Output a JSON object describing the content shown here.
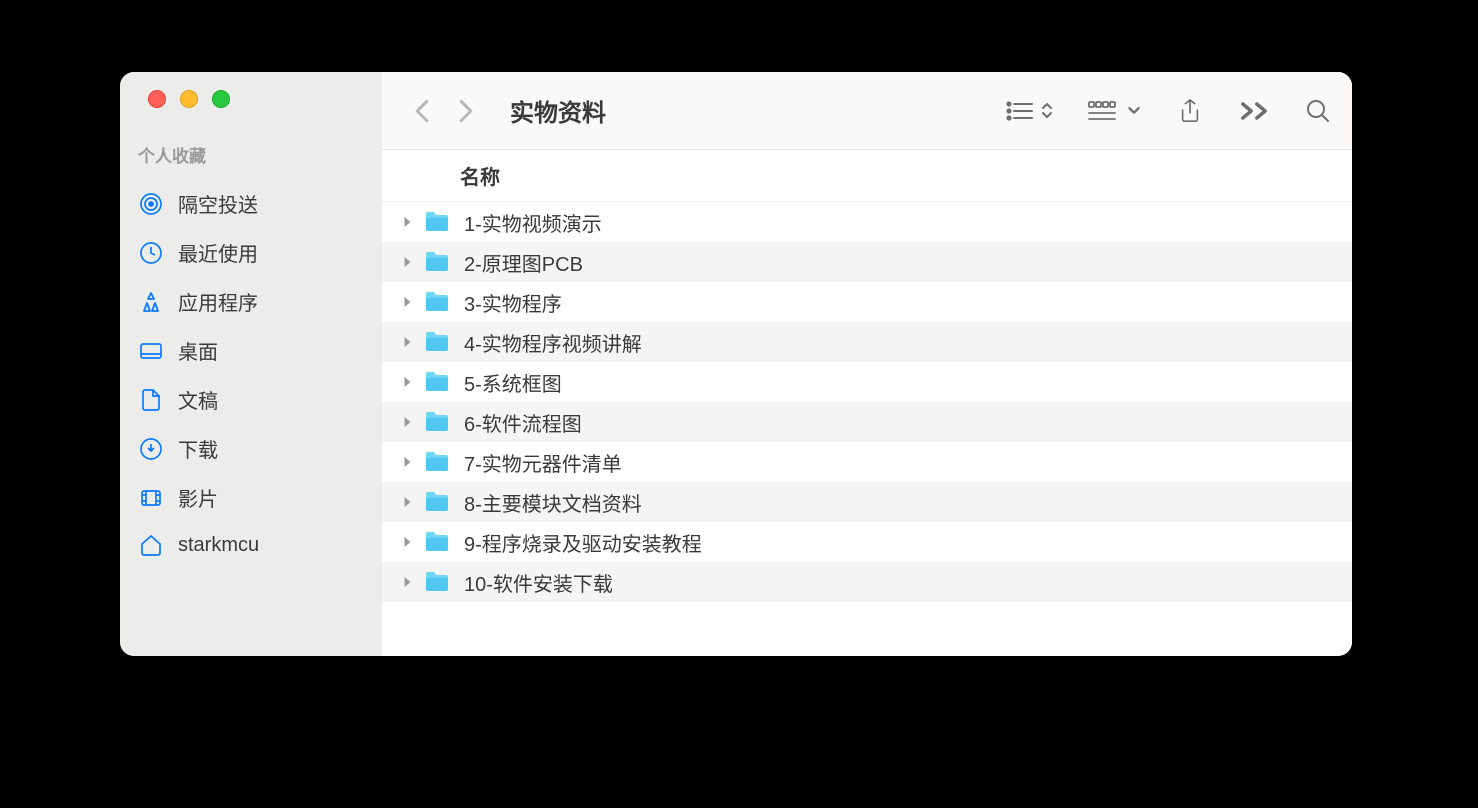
{
  "window": {
    "title": "实物资料"
  },
  "sidebar": {
    "section_title": "个人收藏",
    "items": [
      {
        "icon": "airdrop",
        "label": "隔空投送"
      },
      {
        "icon": "clock",
        "label": "最近使用"
      },
      {
        "icon": "apps",
        "label": "应用程序"
      },
      {
        "icon": "desktop",
        "label": "桌面"
      },
      {
        "icon": "doc",
        "label": "文稿"
      },
      {
        "icon": "download",
        "label": "下载"
      },
      {
        "icon": "movie",
        "label": "影片"
      },
      {
        "icon": "home",
        "label": "starkmcu"
      }
    ]
  },
  "list": {
    "column_name": "名称",
    "rows": [
      {
        "name": "1-实物视频演示"
      },
      {
        "name": "2-原理图PCB"
      },
      {
        "name": "3-实物程序"
      },
      {
        "name": "4-实物程序视频讲解"
      },
      {
        "name": "5-系统框图"
      },
      {
        "name": "6-软件流程图"
      },
      {
        "name": "7-实物元器件清单"
      },
      {
        "name": "8-主要模块文档资料"
      },
      {
        "name": "9-程序烧录及驱动安装教程"
      },
      {
        "name": "10-软件安装下载"
      }
    ]
  }
}
